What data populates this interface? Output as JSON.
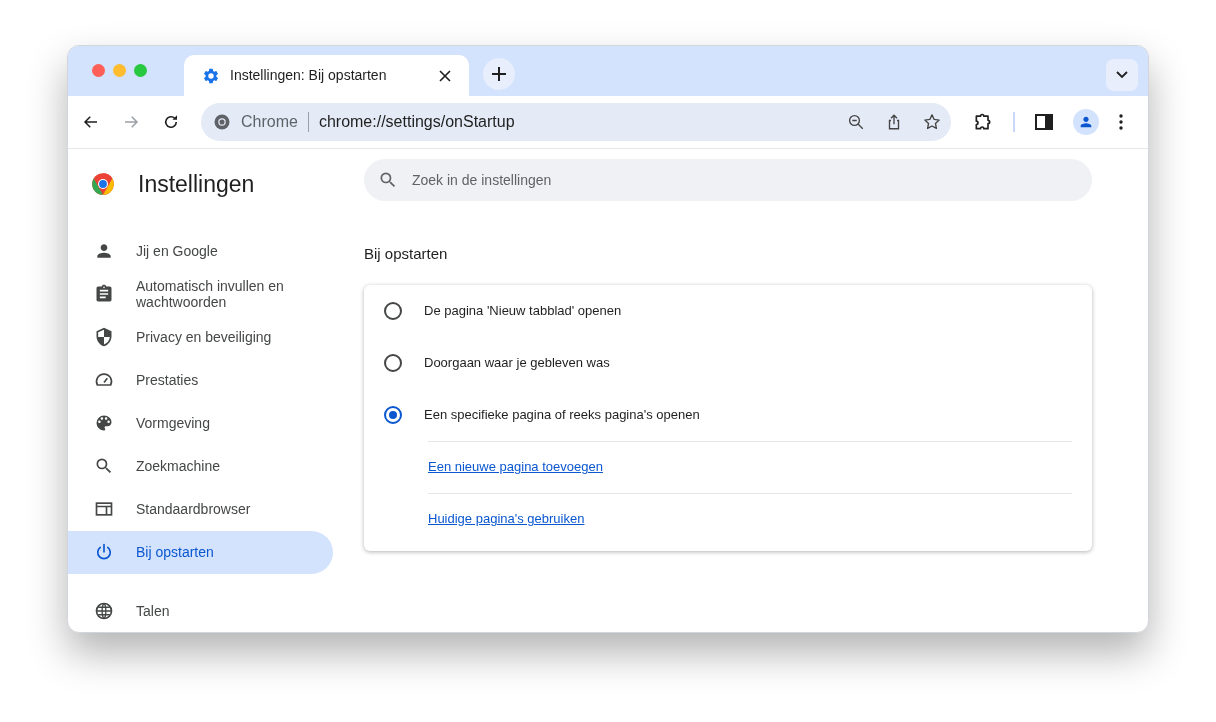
{
  "tab": {
    "title": "Instellingen: Bij opstarten"
  },
  "omnibox": {
    "chip": "Chrome",
    "url": "chrome://settings/onStartup"
  },
  "sidebar": {
    "title": "Instellingen",
    "items": [
      {
        "kind": "person",
        "label": "Jij en Google",
        "selected": false
      },
      {
        "kind": "clipboard",
        "label": "Automatisch invullen en wachtwoorden",
        "selected": false
      },
      {
        "kind": "shield",
        "label": "Privacy en beveiliging",
        "selected": false
      },
      {
        "kind": "gauge",
        "label": "Prestaties",
        "selected": false
      },
      {
        "kind": "palette",
        "label": "Vormgeving",
        "selected": false
      },
      {
        "kind": "search",
        "label": "Zoekmachine",
        "selected": false
      },
      {
        "kind": "browser",
        "label": "Standaardbrowser",
        "selected": false
      },
      {
        "kind": "power",
        "label": "Bij opstarten",
        "selected": true
      }
    ],
    "more_items": [
      {
        "kind": "globe",
        "label": "Talen",
        "selected": false
      }
    ]
  },
  "search": {
    "placeholder": "Zoek in de instellingen"
  },
  "section": {
    "title": "Bij opstarten",
    "options": [
      {
        "label": "De pagina 'Nieuw tabblad' openen",
        "selected": false
      },
      {
        "label": "Doorgaan waar je gebleven was",
        "selected": false
      },
      {
        "label": "Een specifieke pagina of reeks pagina's openen",
        "selected": true
      }
    ],
    "links": [
      "Een nieuwe pagina toevoegen",
      "Huidige pagina's gebruiken"
    ]
  }
}
